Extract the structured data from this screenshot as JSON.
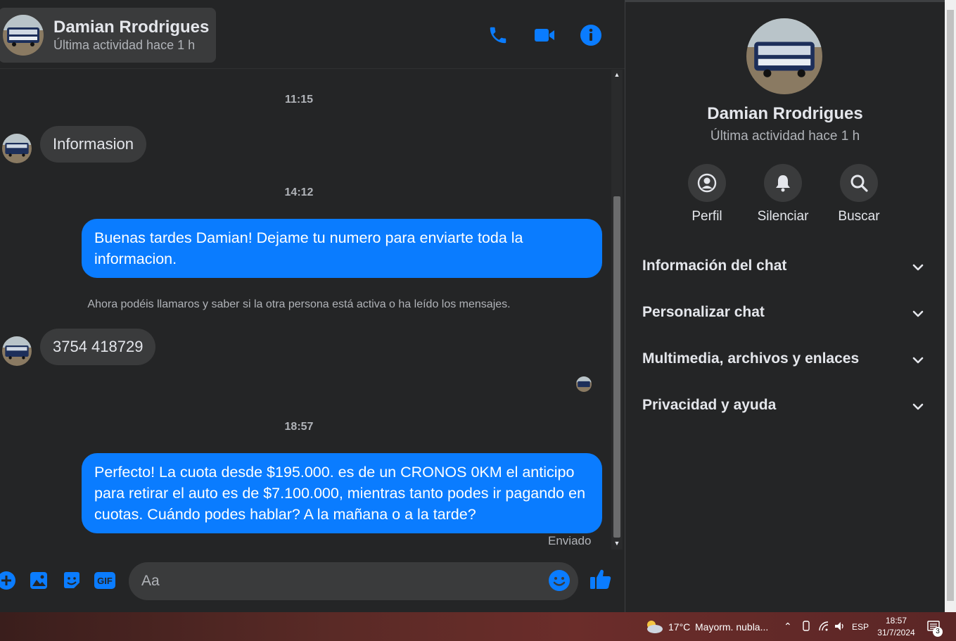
{
  "header": {
    "name": "Damian Rrodrigues",
    "status": "Última actividad hace 1 h",
    "icons": [
      "phone-icon",
      "video-camera-icon",
      "info-icon"
    ]
  },
  "messages": {
    "ts1": "11:15",
    "msg1": "Informasion",
    "ts2": "14:12",
    "msg2": "Buenas tardes Damian! Dejame tu numero para enviarte toda la informacion.",
    "notice": "Ahora podéis llamaros y saber si la otra persona está activa o ha leído los mensajes.",
    "msg3": "3754 418729",
    "ts3": "18:57",
    "msg4": "Perfecto! La cuota desde $195.000. es de un CRONOS 0KM el anticipo para retirar el auto es de $7.100.000, mientras tanto podes ir pagando en cuotas. Cuándo podes hablar? A la mañana o a la tarde?",
    "sent_label": "Enviado"
  },
  "composer": {
    "placeholder": "Aa",
    "icons": [
      "plus-icon",
      "image-icon",
      "sticker-icon",
      "gif-icon",
      "emoji-icon",
      "thumbs-up-icon"
    ],
    "gif_label": "GIF"
  },
  "panel": {
    "name": "Damian Rrodrigues",
    "status": "Última actividad hace 1 h",
    "actions": [
      {
        "label": "Perfil",
        "icon": "profile-icon"
      },
      {
        "label": "Silenciar",
        "icon": "bell-icon"
      },
      {
        "label": "Buscar",
        "icon": "search-icon"
      }
    ],
    "sections": [
      {
        "title": "Información del chat"
      },
      {
        "title": "Personalizar chat"
      },
      {
        "title": "Multimedia, archivos y enlaces"
      },
      {
        "title": "Privacidad y ayuda"
      }
    ]
  },
  "taskbar": {
    "temperature": "17°C",
    "weather": "Mayorm. nubla...",
    "language": "ESP",
    "time": "18:57",
    "date": "31/7/2024",
    "notifications": "3"
  },
  "colors": {
    "accent": "#0a7cff",
    "background": "#242526",
    "bubble_in": "#3a3b3c"
  }
}
